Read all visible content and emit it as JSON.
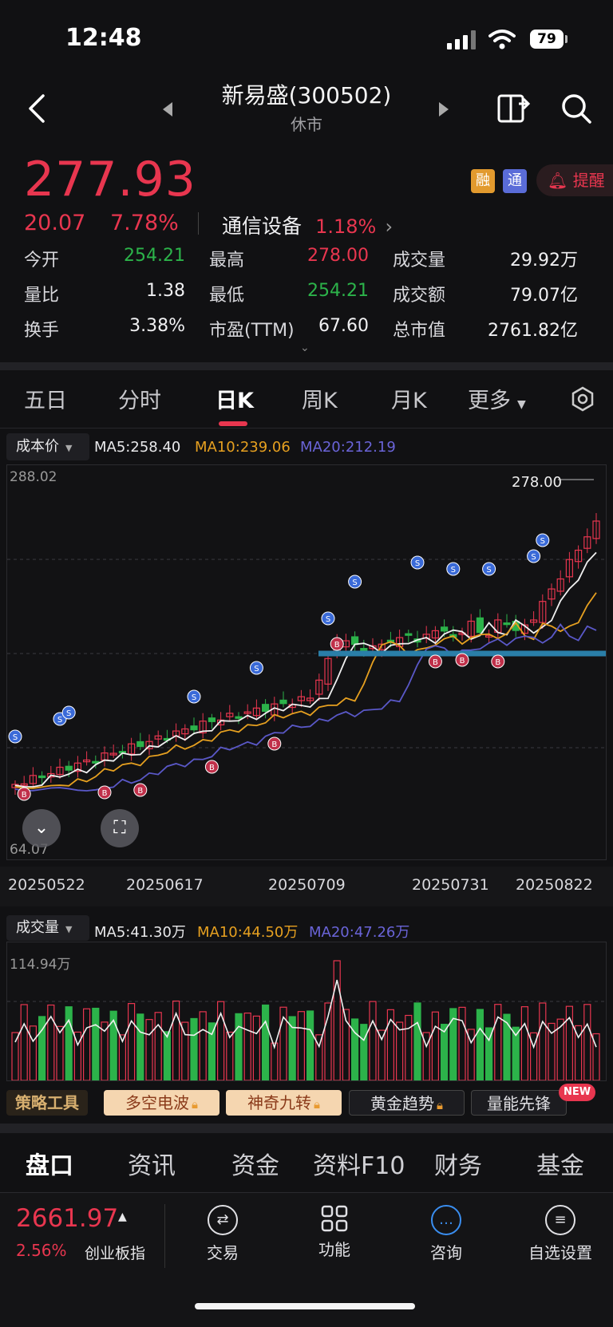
{
  "status": {
    "time": "12:48",
    "battery": "79"
  },
  "header": {
    "title": "新易盛(300502)",
    "subtitle": "休市"
  },
  "quote": {
    "price": "277.93",
    "change": "20.07",
    "change_pct": "7.78%",
    "sector_name": "通信设备",
    "sector_pct": "1.18%",
    "badge_rong": "融",
    "badge_tong": "通",
    "alert_label": "提醒",
    "stats": [
      {
        "label": "今开",
        "value": "254.21",
        "color": "green"
      },
      {
        "label": "最高",
        "value": "278.00",
        "color": "red"
      },
      {
        "label": "成交量",
        "value": "29.92万",
        "color": "white"
      },
      {
        "label": "量比",
        "value": "1.38",
        "color": "white"
      },
      {
        "label": "最低",
        "value": "254.21",
        "color": "green"
      },
      {
        "label": "成交额",
        "value": "79.07亿",
        "color": "white"
      },
      {
        "label": "换手",
        "value": "3.38%",
        "color": "white"
      },
      {
        "label": "市盈(TTM)",
        "value": "67.60",
        "color": "white"
      },
      {
        "label": "总市值",
        "value": "2761.82亿",
        "color": "white"
      }
    ]
  },
  "period_tabs": [
    {
      "label": "五日",
      "active": false
    },
    {
      "label": "分时",
      "active": false
    },
    {
      "label": "日K",
      "active": true
    },
    {
      "label": "周K",
      "active": false
    },
    {
      "label": "月K",
      "active": false
    },
    {
      "label": "更多",
      "active": false
    }
  ],
  "kline": {
    "selector": "成本价",
    "ma5": "MA5:258.40",
    "ma10": "MA10:239.06",
    "ma20": "MA20:212.19",
    "top_label": "288.02",
    "high_marker": "278.00",
    "bottom_label": "64.07",
    "dates": [
      "20250522",
      "20250617",
      "20250709",
      "20250731",
      "20250822"
    ]
  },
  "volume": {
    "selector": "成交量",
    "ma5": "MA5:41.30万",
    "ma10": "MA10:44.50万",
    "ma20": "MA20:47.26万",
    "top_label": "114.94万"
  },
  "strategy": {
    "title": "策略工具",
    "tools": [
      "多空电波",
      "神奇九转",
      "黄金趋势",
      "量能先锋"
    ],
    "new_badge": "NEW"
  },
  "bottom_tabs": [
    {
      "label": "盘口",
      "active": true
    },
    {
      "label": "资讯",
      "active": false
    },
    {
      "label": "资金",
      "active": false
    },
    {
      "label": "资料F10",
      "active": false
    },
    {
      "label": "财务",
      "active": false
    },
    {
      "label": "基金",
      "active": false
    }
  ],
  "index": {
    "value": "2661.97",
    "pct": "2.56%",
    "name": "创业板指"
  },
  "nav": [
    {
      "label": "交易",
      "icon": "exchange-icon"
    },
    {
      "label": "功能",
      "icon": "grid-icon"
    },
    {
      "label": "咨询",
      "icon": "chat-icon"
    },
    {
      "label": "自选设置",
      "icon": "list-icon"
    }
  ],
  "colors": {
    "up": "#e8364f",
    "down": "#2cb34a",
    "ma5": "#f0f0f0",
    "ma10": "#e6a020",
    "ma20": "#5a58c8",
    "bg": "#111113"
  }
}
